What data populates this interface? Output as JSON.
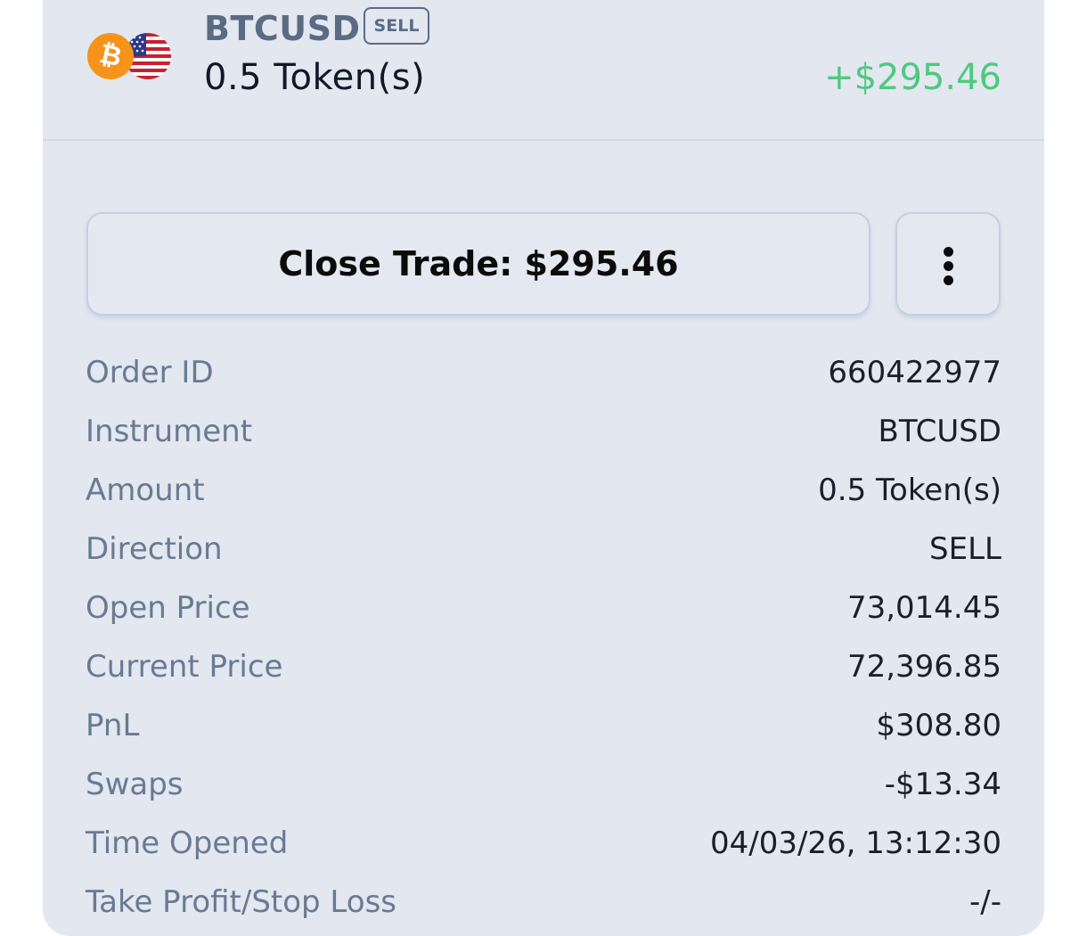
{
  "header": {
    "symbol": "BTCUSD",
    "direction_badge": "SELL",
    "quantity": "0.5 Token(s)",
    "pnl": "+$295.46",
    "icons": [
      "bitcoin-icon",
      "us-flag-icon"
    ],
    "colors": {
      "pnl_positive": "#4ec97f",
      "bitcoin": "#f7931a"
    }
  },
  "actions": {
    "close_trade_label": "Close Trade: $295.46",
    "more_icon": "vertical-ellipsis-icon"
  },
  "details": [
    {
      "label": "Order ID",
      "value": "660422977"
    },
    {
      "label": "Instrument",
      "value": "BTCUSD"
    },
    {
      "label": "Amount",
      "value": "0.5 Token(s)"
    },
    {
      "label": "Direction",
      "value": "SELL"
    },
    {
      "label": "Open Price",
      "value": "73,014.45"
    },
    {
      "label": "Current Price",
      "value": "72,396.85"
    },
    {
      "label": "PnL",
      "value": "$308.80"
    },
    {
      "label": "Swaps",
      "value": "-$13.34"
    },
    {
      "label": "Time Opened",
      "value": "04/03/26, 13:12:30"
    },
    {
      "label": "Take Profit/Stop Loss",
      "value": "-/-"
    }
  ]
}
